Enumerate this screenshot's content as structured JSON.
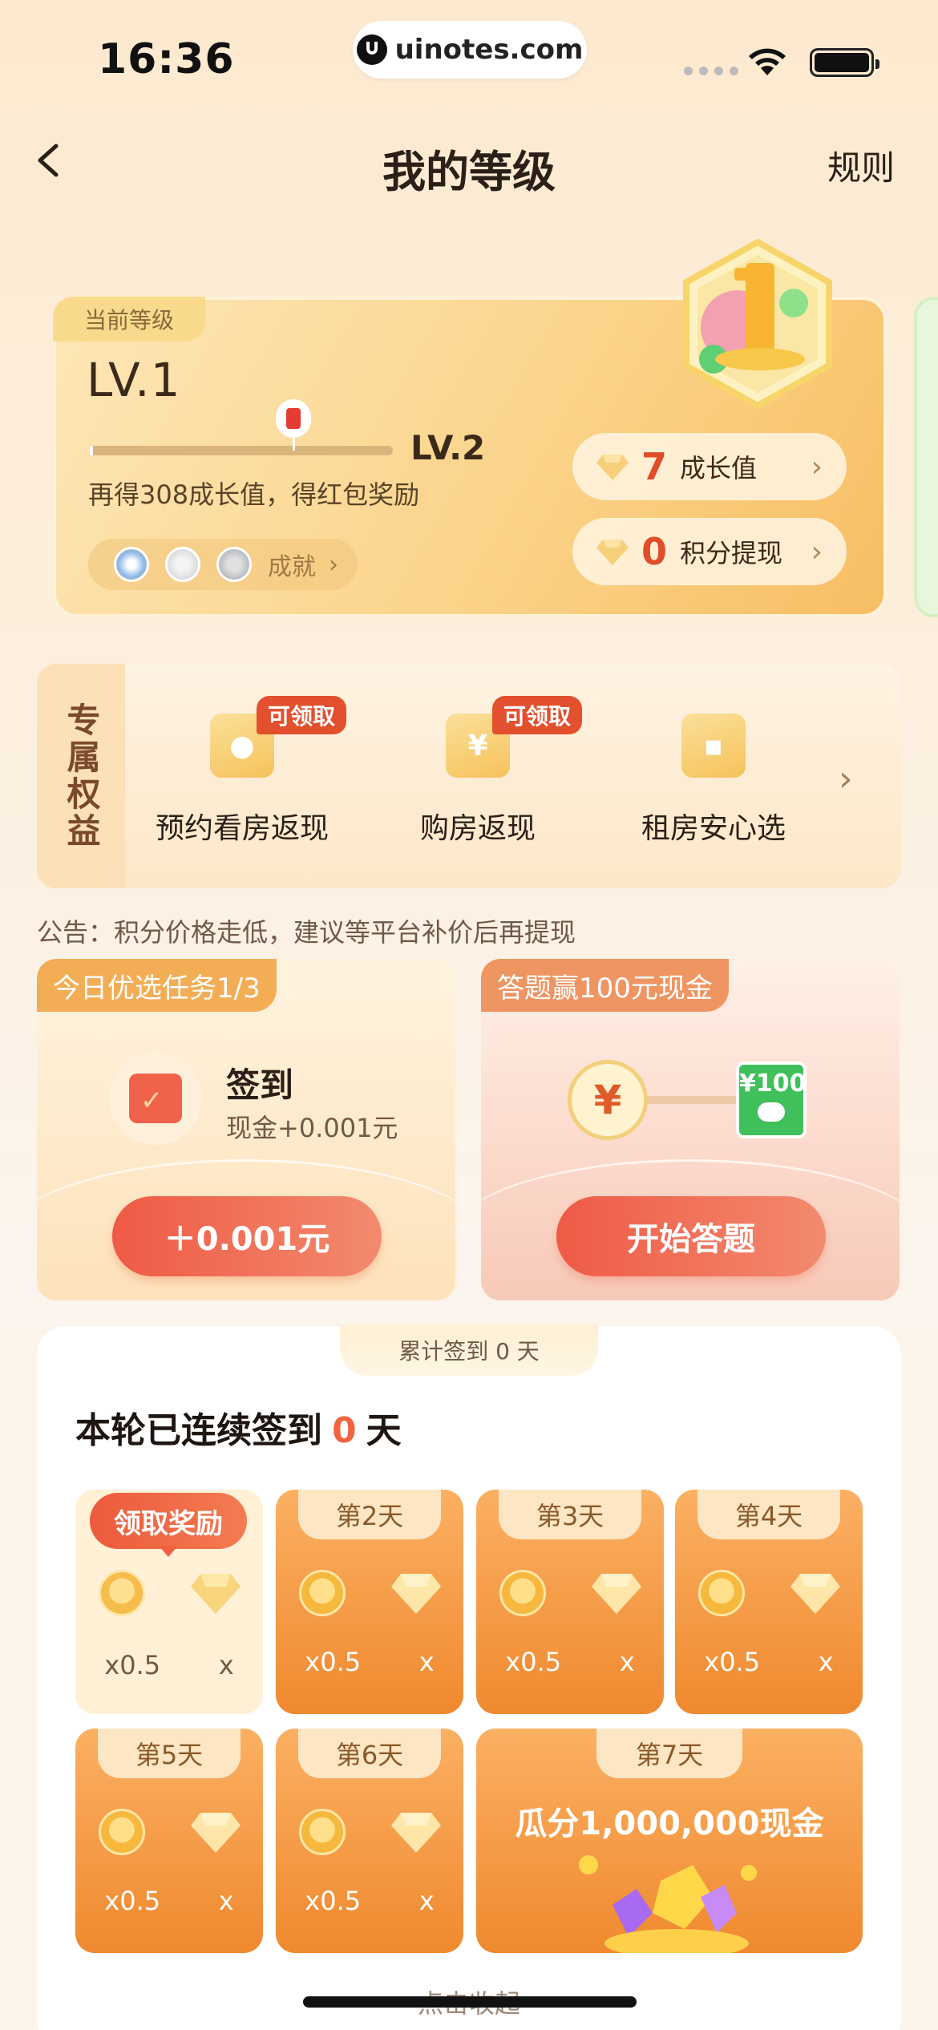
{
  "status": {
    "time": "16:36",
    "url": "uinotes.com"
  },
  "nav": {
    "title": "我的等级",
    "rules": "规则"
  },
  "level": {
    "current_tag": "当前等级",
    "current": "LV.1",
    "next": "LV.2",
    "hint": "再得308成长值，得红包奖励",
    "achievement_label": "成就",
    "growth": {
      "value": "7",
      "label": "成长值"
    },
    "points": {
      "value": "0",
      "label": "积分提现"
    }
  },
  "benefits": {
    "side_label": "专属权益",
    "items": [
      {
        "label": "预约看房返现",
        "tag": "可领取",
        "icon": "person-icon"
      },
      {
        "label": "购房返现",
        "tag": "可领取",
        "icon": "yen-icon"
      },
      {
        "label": "租房安心选",
        "tag": "",
        "icon": "building-icon"
      }
    ]
  },
  "notice": "公告：积分价格走低，建议等平台补价后再提现",
  "task_left": {
    "tag": "今日优选任务1/3",
    "title": "签到",
    "subtitle": "现金+0.001元",
    "button": "＋0.001元"
  },
  "task_right": {
    "tag": "答题赢100元现金",
    "yuan": "¥",
    "bill": "¥100",
    "button": "开始答题"
  },
  "checkin": {
    "accum": "累计签到 0 天",
    "streak_prefix": "本轮已连续签到",
    "streak_value": "0",
    "streak_suffix": "天",
    "claim": "领取奖励",
    "days": [
      {
        "label": "",
        "coin": "x0.5",
        "gem": "x"
      },
      {
        "label": "第2天",
        "coin": "x0.5",
        "gem": "x"
      },
      {
        "label": "第3天",
        "coin": "x0.5",
        "gem": "x"
      },
      {
        "label": "第4天",
        "coin": "x0.5",
        "gem": "x"
      },
      {
        "label": "第5天",
        "coin": "x0.5",
        "gem": "x"
      },
      {
        "label": "第6天",
        "coin": "x0.5",
        "gem": "x"
      }
    ],
    "day7": {
      "label": "第7天",
      "text": "瓜分1,000,000现金"
    },
    "collapse": "点击收起"
  },
  "colors": {
    "accent": "#f0653e",
    "gold": "#f7be63"
  }
}
